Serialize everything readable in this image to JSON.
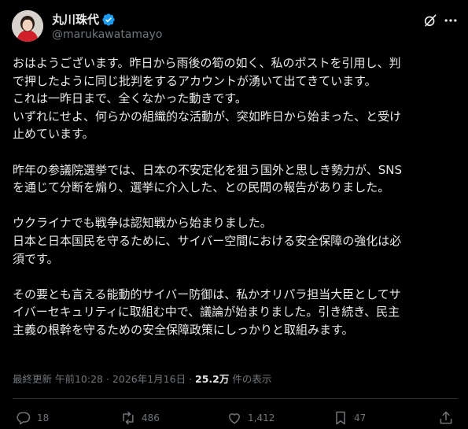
{
  "author": {
    "name": "丸川珠代",
    "handle": "@marukawatamayo",
    "verified_color": "#1d9bf0"
  },
  "icons": {
    "grok": "grok-icon",
    "more": "more-icon"
  },
  "post": {
    "lines": [
      "おはようございます。昨日から雨後の筍の如く、私のポストを引用し、判",
      "で押したように同じ批判をするアカウントが湧いて出てきています。",
      "これは一昨日まで、全くなかった動きです。",
      "いずれにせよ、何らかの組織的な活動が、突如昨日から始まった、と受け",
      "止めています。",
      "",
      "昨年の参議院選挙では、日本の不安定化を狙う国外と思しき勢力が、SNS",
      "を通じて分断を煽り、選挙に介入した、との民間の報告がありました。",
      "",
      "ウクライナでも戦争は認知戦から始まりました。",
      "日本と日本国民を守るために、サイバー空間における安全保障の強化は必",
      "須です。",
      "",
      "その要とも言える能動的サイバー防御は、私かオリパラ担当大臣としてサ",
      "イバーセキュリティに取組む中で、議論が始まりました。引き続き、民主",
      "主義の根幹を守るための安全保障政策にしっかりと取組みます。"
    ]
  },
  "meta": {
    "prefix": "最終更新 午前10:28 · 2026年1月16日 · ",
    "views": "25.2万",
    "suffix": " 件の表示"
  },
  "actions": {
    "replies": "18",
    "reposts": "486",
    "likes": "1,412",
    "bookmarks": "47"
  }
}
